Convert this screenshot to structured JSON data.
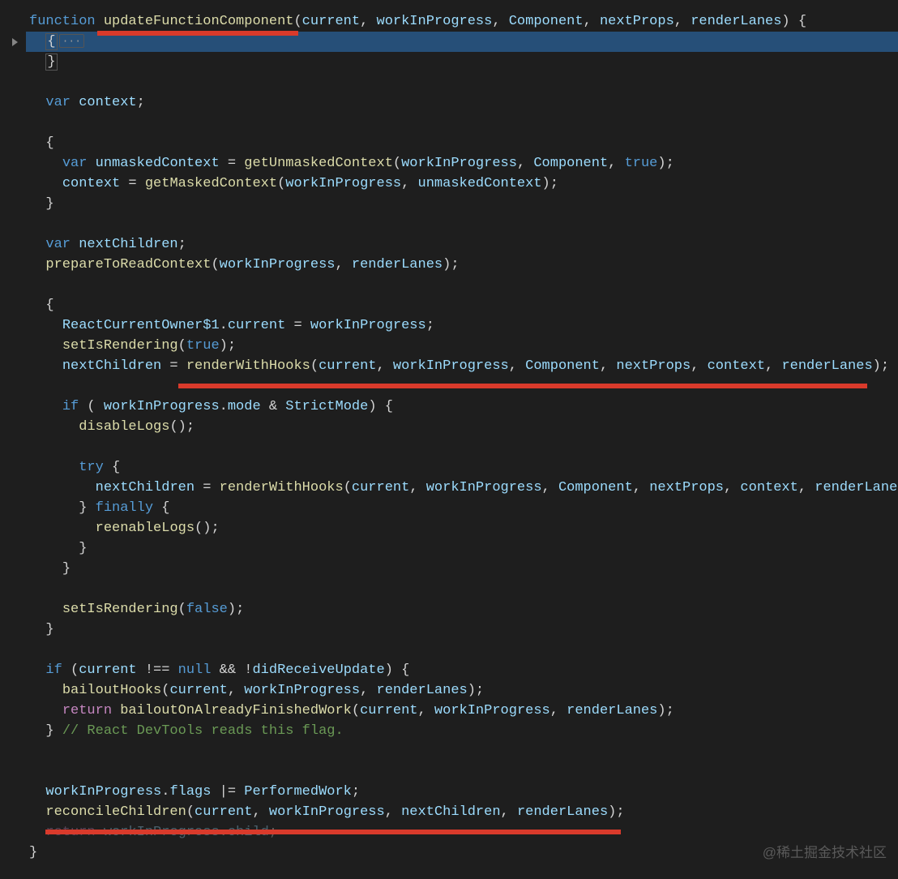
{
  "watermark": "@稀土掘金技术社区",
  "fold_marker": "···",
  "code": {
    "l1": {
      "pre": "",
      "kw": "function",
      "sp": " ",
      "fn": "updateFunctionComponent",
      "po": "(",
      "a1": "current",
      "c1": ", ",
      "a2": "workInProgress",
      "c2": ", ",
      "a3": "Component",
      "c3": ", ",
      "a4": "nextProps",
      "c4": ", ",
      "a5": "renderLanes",
      "pc": ")",
      "sp2": " ",
      "ob": "{"
    },
    "l2": {
      "pre": "  ",
      "lb": "{"
    },
    "l3": {
      "pre": "  ",
      "rb": "}"
    },
    "l5": {
      "pre": "  ",
      "kw": "var",
      "sp": " ",
      "v": "context",
      "semi": ";"
    },
    "l7": {
      "pre": "  ",
      "ob": "{"
    },
    "l8": {
      "pre": "    ",
      "kw": "var",
      "sp": " ",
      "v": "unmaskedContext",
      "eq": " = ",
      "fn": "getUnmaskedContext",
      "po": "(",
      "a1": "workInProgress",
      "c1": ", ",
      "a2": "Component",
      "c2": ", ",
      "lit": "true",
      "pc": ")",
      "semi": ";"
    },
    "l9": {
      "pre": "    ",
      "v": "context",
      "eq": " = ",
      "fn": "getMaskedContext",
      "po": "(",
      "a1": "workInProgress",
      "c1": ", ",
      "a2": "unmaskedContext",
      "pc": ")",
      "semi": ";"
    },
    "l10": {
      "pre": "  ",
      "cb": "}"
    },
    "l12": {
      "pre": "  ",
      "kw": "var",
      "sp": " ",
      "v": "nextChildren",
      "semi": ";"
    },
    "l13": {
      "pre": "  ",
      "fn": "prepareToReadContext",
      "po": "(",
      "a1": "workInProgress",
      "c1": ", ",
      "a2": "renderLanes",
      "pc": ")",
      "semi": ";"
    },
    "l15": {
      "pre": "  ",
      "ob": "{"
    },
    "l16": {
      "pre": "    ",
      "obj": "ReactCurrentOwner$1",
      "dot": ".",
      "prop": "current",
      "eq": " = ",
      "v": "workInProgress",
      "semi": ";"
    },
    "l17": {
      "pre": "    ",
      "fn": "setIsRendering",
      "po": "(",
      "lit": "true",
      "pc": ")",
      "semi": ";"
    },
    "l18": {
      "pre": "    ",
      "v": "nextChildren",
      "eq": " = ",
      "fn": "renderWithHooks",
      "po": "(",
      "a1": "current",
      "c1": ", ",
      "a2": "workInProgress",
      "c2": ", ",
      "a3": "Component",
      "c3": ", ",
      "a4": "nextProps",
      "c4": ", ",
      "a5": "context",
      "c5": ", ",
      "a6": "renderLanes",
      "pc": ")",
      "semi": ";"
    },
    "l20": {
      "pre": "    ",
      "kw": "if",
      "po": " ( ",
      "v": "workInProgress",
      "dot": ".",
      "prop": "mode",
      "op": " & ",
      "v2": "StrictMode",
      "pc": ")",
      "sp": " ",
      "ob": "{"
    },
    "l21": {
      "pre": "      ",
      "fn": "disableLogs",
      "po": "(",
      "pc": ")",
      "semi": ";"
    },
    "l23": {
      "pre": "      ",
      "kw": "try",
      "sp": " ",
      "ob": "{"
    },
    "l24": {
      "pre": "        ",
      "v": "nextChildren",
      "eq": " = ",
      "fn": "renderWithHooks",
      "po": "(",
      "a1": "current",
      "c1": ", ",
      "a2": "workInProgress",
      "c2": ", ",
      "a3": "Component",
      "c3": ", ",
      "a4": "nextProps",
      "c4": ", ",
      "a5": "context",
      "c5": ", ",
      "a6": "renderLanes",
      "pc": ")",
      "semi": ";"
    },
    "l25": {
      "pre": "      ",
      "cb": "}",
      "sp": " ",
      "kw": "finally",
      "sp2": " ",
      "ob": "{"
    },
    "l26": {
      "pre": "        ",
      "fn": "reenableLogs",
      "po": "(",
      "pc": ")",
      "semi": ";"
    },
    "l27": {
      "pre": "      ",
      "cb": "}"
    },
    "l28": {
      "pre": "    ",
      "cb": "}"
    },
    "l30": {
      "pre": "    ",
      "fn": "setIsRendering",
      "po": "(",
      "lit": "false",
      "pc": ")",
      "semi": ";"
    },
    "l31": {
      "pre": "  ",
      "cb": "}"
    },
    "l33": {
      "pre": "  ",
      "kw": "if",
      "po": " (",
      "v": "current",
      "op": " !== ",
      "lit": "null",
      "op2": " && !",
      "v2": "didReceiveUpdate",
      "pc": ")",
      "sp": " ",
      "ob": "{"
    },
    "l34": {
      "pre": "    ",
      "fn": "bailoutHooks",
      "po": "(",
      "a1": "current",
      "c1": ", ",
      "a2": "workInProgress",
      "c2": ", ",
      "a3": "renderLanes",
      "pc": ")",
      "semi": ";"
    },
    "l35": {
      "pre": "    ",
      "kw": "return",
      "sp": " ",
      "fn": "bailoutOnAlreadyFinishedWork",
      "po": "(",
      "a1": "current",
      "c1": ", ",
      "a2": "workInProgress",
      "c2": ", ",
      "a3": "renderLanes",
      "pc": ")",
      "semi": ";"
    },
    "l36": {
      "pre": "  ",
      "cb": "}",
      "sp": " ",
      "cm": "// React DevTools reads this flag."
    },
    "l39": {
      "pre": "  ",
      "v": "workInProgress",
      "dot": ".",
      "prop": "flags",
      "op": " |= ",
      "v2": "PerformedWork",
      "semi": ";"
    },
    "l40": {
      "pre": "  ",
      "fn": "reconcileChildren",
      "po": "(",
      "a1": "current",
      "c1": ", ",
      "a2": "workInProgress",
      "c2": ", ",
      "a3": "nextChildren",
      "c3": ", ",
      "a4": "renderLanes",
      "pc": ")",
      "semi": ";"
    },
    "l41": {
      "pre": "  ",
      "kw": "return",
      "sp": " ",
      "v": "workInProgress",
      "dot": ".",
      "prop": "child",
      "semi": ";"
    },
    "l42": {
      "pre": "",
      "cb": "}"
    }
  }
}
